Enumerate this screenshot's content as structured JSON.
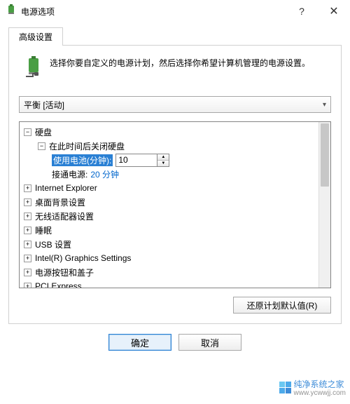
{
  "titlebar": {
    "title": "电源选项",
    "help": "?",
    "close": "✕"
  },
  "tabs": {
    "advanced": "高级设置"
  },
  "intro": {
    "text": "选择你要自定义的电源计划，然后选择你希望计算机管理的电源设置。"
  },
  "plan": {
    "selected": "平衡 [活动]"
  },
  "tree": {
    "hard_disk": "硬盘",
    "turn_off_after": "在此时间后关闭硬盘",
    "on_battery_label": "使用电池(分钟):",
    "on_battery_value": "10",
    "plugged_in_label": "接通电源:",
    "plugged_in_value": "20 分钟",
    "ie": "Internet Explorer",
    "desktop_bg": "桌面背景设置",
    "wireless": "无线适配器设置",
    "sleep": "睡眠",
    "usb": "USB 设置",
    "intel_gfx": "Intel(R) Graphics Settings",
    "power_buttons": "电源按钮和盖子",
    "pci": "PCI Express"
  },
  "buttons": {
    "restore": "还原计划默认值(R)",
    "ok": "确定",
    "cancel": "取消"
  },
  "watermark": {
    "name": "纯净系统之家",
    "url": "www.ycwwjj.com"
  }
}
